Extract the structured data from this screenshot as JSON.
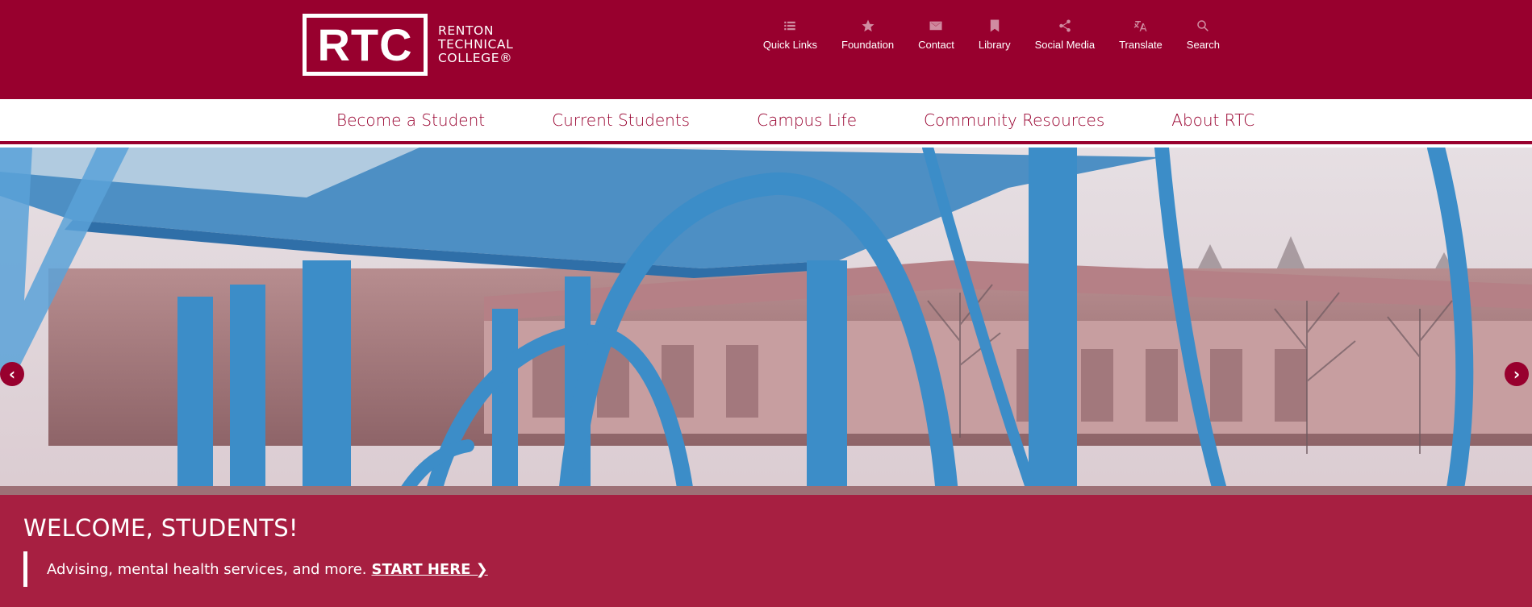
{
  "logo": {
    "mark": "RTC",
    "line1": "RENTON",
    "line2": "TECHNICAL",
    "line3": "COLLEGE®"
  },
  "utility_nav": [
    {
      "label": "Quick Links",
      "icon": "list-icon"
    },
    {
      "label": "Foundation",
      "icon": "star-icon"
    },
    {
      "label": "Contact",
      "icon": "mail-icon"
    },
    {
      "label": "Library",
      "icon": "bookmark-icon"
    },
    {
      "label": "Social Media",
      "icon": "share-icon"
    },
    {
      "label": "Translate",
      "icon": "translate-icon"
    },
    {
      "label": "Search",
      "icon": "search-icon"
    }
  ],
  "main_nav": [
    {
      "label": "Become a Student"
    },
    {
      "label": "Current Students"
    },
    {
      "label": "Campus Life"
    },
    {
      "label": "Community Resources"
    },
    {
      "label": "About RTC"
    }
  ],
  "hero": {
    "title": "WELCOME, STUDENTS!",
    "body": "Advising, mental health services, and more.",
    "link": "START HERE ❯",
    "prev_arrow": "‹",
    "next_arrow": "›"
  },
  "colors": {
    "brand": "#98002e",
    "caption_overlay": "rgba(170, 0, 45, 0.72)",
    "structure_blue": "#3c8dc8"
  }
}
